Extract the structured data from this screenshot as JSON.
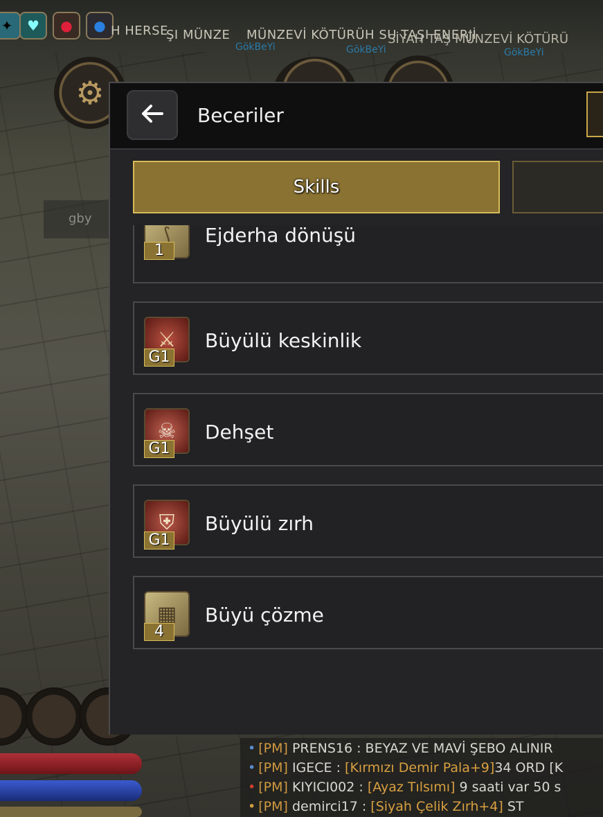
{
  "hud": {
    "scroll_text_1": "H HERSE",
    "scroll_text_2": "ŞI MÜNZE",
    "scroll_text_3": "MÜNZEVİ KÖTÜRÜH SU TAŞI ENERJİ",
    "scroll_text_4": "SİYAH TAŞ MÜNZEVİ KÖTÜRÜ",
    "nametag_1": "GökBeYi",
    "nametag_2": "GökBeYi",
    "nametag_3": "GökBeYi",
    "gby_label": "gby",
    "buff_icons": [
      "wing-icon",
      "heart-charm-icon",
      "red-potion-icon",
      "blue-potion-icon"
    ],
    "settings_icon": "gear-icon"
  },
  "panel": {
    "title": "Beceriler",
    "back_icon": "arrow-left-icon",
    "tabs": [
      {
        "label": "Skills",
        "active": true
      },
      {
        "label": "",
        "active": false
      }
    ],
    "skills": [
      {
        "name": "Ejderha dönüşü",
        "level": "1",
        "icon": "claw-icon"
      },
      {
        "name": "Büyülü keskinlik",
        "level": "G1",
        "icon": "sword-icon"
      },
      {
        "name": "Dehşet",
        "level": "G1",
        "icon": "skull-icon"
      },
      {
        "name": "Büyülü zırh",
        "level": "G1",
        "icon": "armor-icon"
      },
      {
        "name": "Büyü çözme",
        "level": "4",
        "icon": "rune-icon"
      }
    ]
  },
  "chat": [
    {
      "prefix": "[PM]",
      "text": "PRENS16 : BEYAZ VE MAVİ ŞEBO ALINIR"
    },
    {
      "prefix": "[PM]",
      "text": "IGECE : ",
      "item": "[Kırmızı Demir Pala+9]",
      "rest": "34 ORD [K"
    },
    {
      "prefix": "[PM]",
      "text": "KIYICI002 : ",
      "item": "[Ayaz Tılsımı]",
      "rest": " 9 saati var 50 s"
    },
    {
      "prefix": "[PM]",
      "text": "demirci17 : ",
      "item": "[Siyah Çelik Zırh+4]",
      "rest": " ST"
    }
  ],
  "colors": {
    "accent_gold": "#8a7232",
    "accent_gold_border": "#d8bc5a",
    "panel_bg": "#242426",
    "header_bg": "#0f0f10"
  }
}
